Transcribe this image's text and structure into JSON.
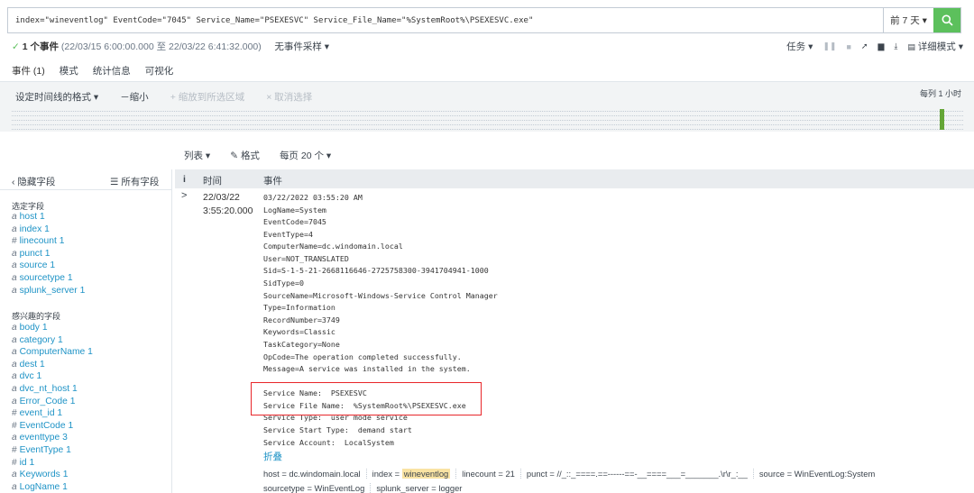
{
  "search": {
    "query": "index=\"wineventlog\" EventCode=\"7045\" Service_Name=\"PSEXESVC\" Service_File_Name=\"%SystemRoot%\\PSEXESVC.exe\"",
    "time_range": "前 7 天 ▾"
  },
  "status": {
    "check": "✓",
    "event_count": "1 个事件",
    "range": "(22/03/15 6:00:00.000 至 22/03/22 6:41:32.000)",
    "sampling": "无事件采样 ▾",
    "job": "任务 ▾",
    "mode": "详细模式 ▾"
  },
  "tabs": [
    "事件 (1)",
    "模式",
    "统计信息",
    "可视化"
  ],
  "timeline": {
    "format": "设定时间线的格式 ▾",
    "zoom_out": "－缩小",
    "zoom_selection": "+ 缩放到所选区域",
    "deselect": "× 取消选择",
    "per_column": "每列 1 小时"
  },
  "results_controls": {
    "list": "列表 ▾",
    "format": "格式",
    "per_page": "每页 20 个 ▾"
  },
  "sidebar": {
    "hide_fields": "隐藏字段",
    "all_fields": "所有字段",
    "selected_title": "选定字段",
    "selected": [
      {
        "type": "a",
        "name": "host",
        "count": "1"
      },
      {
        "type": "a",
        "name": "index",
        "count": "1"
      },
      {
        "type": "#",
        "name": "linecount",
        "count": "1"
      },
      {
        "type": "a",
        "name": "punct",
        "count": "1"
      },
      {
        "type": "a",
        "name": "source",
        "count": "1"
      },
      {
        "type": "a",
        "name": "sourcetype",
        "count": "1"
      },
      {
        "type": "a",
        "name": "splunk_server",
        "count": "1"
      }
    ],
    "interesting_title": "感兴趣的字段",
    "interesting": [
      {
        "type": "a",
        "name": "body",
        "count": "1"
      },
      {
        "type": "a",
        "name": "category",
        "count": "1"
      },
      {
        "type": "a",
        "name": "ComputerName",
        "count": "1"
      },
      {
        "type": "a",
        "name": "dest",
        "count": "1"
      },
      {
        "type": "a",
        "name": "dvc",
        "count": "1"
      },
      {
        "type": "a",
        "name": "dvc_nt_host",
        "count": "1"
      },
      {
        "type": "a",
        "name": "Error_Code",
        "count": "1"
      },
      {
        "type": "#",
        "name": "event_id",
        "count": "1"
      },
      {
        "type": "#",
        "name": "EventCode",
        "count": "1"
      },
      {
        "type": "a",
        "name": "eventtype",
        "count": "3"
      },
      {
        "type": "#",
        "name": "EventType",
        "count": "1"
      },
      {
        "type": "#",
        "name": "id",
        "count": "1"
      },
      {
        "type": "a",
        "name": "Keywords",
        "count": "1"
      },
      {
        "type": "a",
        "name": "LogName",
        "count": "1"
      }
    ]
  },
  "table": {
    "col_info": "i",
    "col_time": "时间",
    "col_event": "事件",
    "expand": ">",
    "time_date": "22/03/22",
    "time_clock": "3:55:20.000",
    "event_lines": [
      "03/22/2022 03:55:20 AM",
      "LogName=System",
      "EventCode=7045",
      "EventType=4",
      "ComputerName=dc.windomain.local",
      "User=NOT_TRANSLATED",
      "Sid=S-1-5-21-2668116646-2725758300-3941704941-1000",
      "SidType=0",
      "SourceName=Microsoft-Windows-Service Control Manager",
      "Type=Information",
      "RecordNumber=3749",
      "Keywords=Classic",
      "TaskCategory=None",
      "OpCode=The operation completed successfully.",
      "Message=A service was installed in the system.",
      "",
      "Service Name:  PSEXESVC",
      "Service File Name:  %SystemRoot%\\PSEXESVC.exe",
      "Service Type:  user mode service",
      "Service Start Type:  demand start",
      "Service Account:  LocalSystem"
    ],
    "fold": "折叠",
    "meta_row1": {
      "host": "host = dc.windomain.local",
      "index_key": "index = ",
      "index_val": "wineventlog",
      "linecount": "linecount = 21",
      "punct": "punct = //_::_====.==------==-__====___=_______.\\r\\r_:__",
      "source": "source = WinEventLog:System"
    },
    "meta_row2": {
      "sourcetype": "sourcetype = WinEventLog",
      "splunk_server": "splunk_server = logger"
    }
  },
  "colors": {
    "accent_green": "#5cc05c",
    "link_blue": "#1e93c6",
    "highlight_red": "#e8262a",
    "timeline_bar": "#65a637"
  }
}
